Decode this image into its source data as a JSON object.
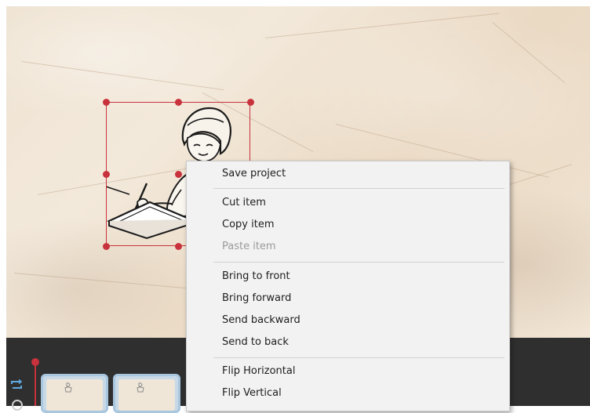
{
  "canvas": {
    "background": "crumpled-paper"
  },
  "sticker": {
    "icon": "woman-writing-illustration-icon",
    "selected": true
  },
  "context_menu": {
    "groups": [
      {
        "items": [
          {
            "label": "Save project",
            "enabled": true
          }
        ]
      },
      {
        "items": [
          {
            "label": "Cut item",
            "enabled": true
          },
          {
            "label": "Copy item",
            "enabled": true
          },
          {
            "label": "Paste item",
            "enabled": false
          }
        ]
      },
      {
        "items": [
          {
            "label": "Bring to front",
            "enabled": true
          },
          {
            "label": "Bring forward",
            "enabled": true
          },
          {
            "label": "Send backward",
            "enabled": true
          },
          {
            "label": "Send to back",
            "enabled": true
          }
        ]
      },
      {
        "items": [
          {
            "label": "Flip Horizontal",
            "enabled": true
          },
          {
            "label": "Flip Vertical",
            "enabled": true
          }
        ]
      }
    ]
  },
  "timeline": {
    "loop_icon": "repeat-icon",
    "frames": [
      {
        "icon": "frame-thumbnail"
      },
      {
        "icon": "frame-thumbnail"
      }
    ]
  },
  "colors": {
    "selection": "#c8323c",
    "timeline_bg": "#2f2f2f",
    "menu_bg": "#f2f2f2",
    "disabled_text": "#9a9a9a",
    "frame_border": "#a8c6de"
  }
}
